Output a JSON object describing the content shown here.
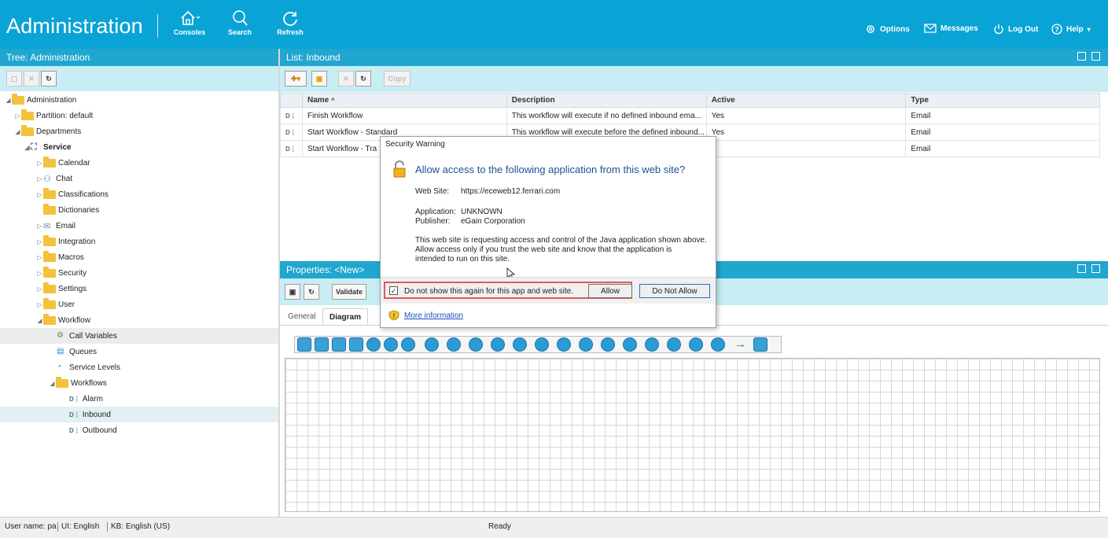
{
  "header": {
    "title": "Administration",
    "consoles": "Consoles",
    "search": "Search",
    "refresh": "Refresh",
    "options": "Options",
    "messages": "Messages",
    "logout": "Log Out",
    "help": "Help"
  },
  "tree_panel": {
    "title": "Tree: Administration",
    "items": [
      {
        "label": "Administration"
      },
      {
        "label": "Partition: default"
      },
      {
        "label": "Departments"
      },
      {
        "label": "Service"
      },
      {
        "label": "Calendar"
      },
      {
        "label": "Chat"
      },
      {
        "label": "Classifications"
      },
      {
        "label": "Dictionaries"
      },
      {
        "label": "Email"
      },
      {
        "label": "Integration"
      },
      {
        "label": "Macros"
      },
      {
        "label": "Security"
      },
      {
        "label": "Settings"
      },
      {
        "label": "User"
      },
      {
        "label": "Workflow"
      },
      {
        "label": "Call Variables"
      },
      {
        "label": "Queues"
      },
      {
        "label": "Service Levels"
      },
      {
        "label": "Workflows"
      },
      {
        "label": "Alarm"
      },
      {
        "label": "Inbound"
      },
      {
        "label": "Outbound"
      }
    ]
  },
  "list_panel": {
    "title": "List: Inbound",
    "copy_label": "Copy",
    "columns": [
      "Name",
      "Description",
      "Active",
      "Type"
    ],
    "rows": [
      {
        "name": "Finish Workflow",
        "description": "This workflow will execute if no defined inbound ema...",
        "active": "Yes",
        "type": "Email"
      },
      {
        "name": "Start Workflow - Standard",
        "description": "This workflow will execute before the defined inbound...",
        "active": "Yes",
        "type": "Email"
      },
      {
        "name": "Start Workflow - Tra",
        "description": "",
        "active": "",
        "type": "Email"
      }
    ]
  },
  "properties_panel": {
    "title": "Properties: <New>",
    "validate_label": "Validate",
    "tabs": [
      {
        "label": "General"
      },
      {
        "label": "Diagram"
      }
    ]
  },
  "dialog": {
    "title": "Security Warning",
    "heading": "Allow access to the following application from this web site?",
    "website_label": "Web Site:",
    "website_value": "https://eceweb12.ferrari.com",
    "application_label": "Application:",
    "application_value": "UNKNOWN",
    "publisher_label": "Publisher:",
    "publisher_value": "eGain Corporation",
    "body_line1": "This web site is requesting access and control of the Java application shown above.",
    "body_line2": "Allow access only if you trust the web site and know that the application is",
    "body_line3": "intended to run on this site.",
    "checkbox_label": "Do not show this again for this app and web site.",
    "allow_label": "Allow",
    "deny_label": "Do Not Allow",
    "more_info_label": "More information"
  },
  "status_bar": {
    "user": "User name: pa",
    "ui": "UI: English",
    "kb": "KB: English (US)",
    "state": "Ready"
  },
  "colors": {
    "header": "#0aa3d6",
    "panel_title": "#20a6cf",
    "toolbar": "#c9edf5",
    "highlight": "#e05a5a"
  }
}
